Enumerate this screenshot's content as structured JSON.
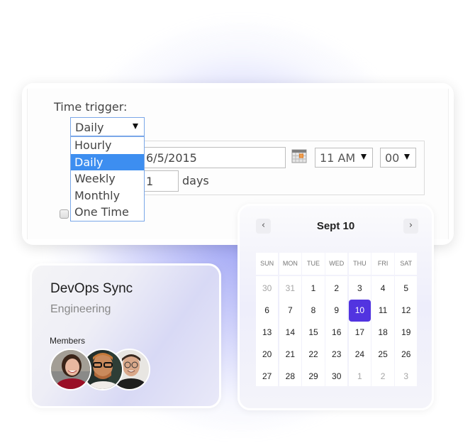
{
  "trigger": {
    "label": "Time trigger:",
    "select_value": "Daily",
    "options": [
      "Hourly",
      "Daily",
      "Weekly",
      "Monthly",
      "One Time"
    ],
    "selected_option": "Daily",
    "date_value": "6/5/2015",
    "hour_value": "11 AM",
    "minute_value": "00",
    "recur_value": "1",
    "recur_unit": "days",
    "calendar_icon": "calendar-icon"
  },
  "team": {
    "title": "DevOps Sync",
    "subtitle": "Engineering",
    "members_label": "Members",
    "members": [
      {
        "name": "member-1"
      },
      {
        "name": "member-2"
      },
      {
        "name": "member-3"
      }
    ]
  },
  "calendar": {
    "title": "Sept 10",
    "prev_icon": "‹",
    "next_icon": "›",
    "weekdays": [
      "SUN",
      "MON",
      "TUE",
      "WED",
      "THU",
      "FRI",
      "SAT"
    ],
    "days": [
      {
        "d": "30",
        "muted": true
      },
      {
        "d": "31",
        "muted": true
      },
      {
        "d": "1"
      },
      {
        "d": "2"
      },
      {
        "d": "3"
      },
      {
        "d": "4"
      },
      {
        "d": "5"
      },
      {
        "d": "6"
      },
      {
        "d": "7"
      },
      {
        "d": "8"
      },
      {
        "d": "9"
      },
      {
        "d": "10",
        "selected": true
      },
      {
        "d": "11"
      },
      {
        "d": "12"
      },
      {
        "d": "13"
      },
      {
        "d": "14"
      },
      {
        "d": "15"
      },
      {
        "d": "16"
      },
      {
        "d": "17"
      },
      {
        "d": "18"
      },
      {
        "d": "19"
      },
      {
        "d": "20"
      },
      {
        "d": "21"
      },
      {
        "d": "22"
      },
      {
        "d": "23"
      },
      {
        "d": "24"
      },
      {
        "d": "25"
      },
      {
        "d": "26"
      },
      {
        "d": "27"
      },
      {
        "d": "28"
      },
      {
        "d": "29"
      },
      {
        "d": "30"
      },
      {
        "d": "1",
        "muted": true
      },
      {
        "d": "2",
        "muted": true
      },
      {
        "d": "3",
        "muted": true
      }
    ],
    "accent_color": "#5234e0"
  }
}
